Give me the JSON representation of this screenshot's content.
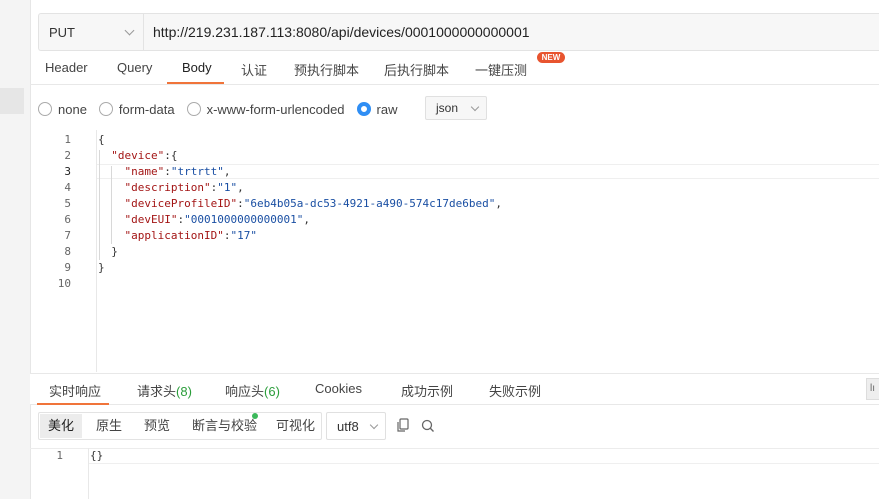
{
  "request": {
    "method": "PUT",
    "url": "http://219.231.187.113:8080/api/devices/0001000000000001"
  },
  "tabs": [
    {
      "label": "Header"
    },
    {
      "label": "Query"
    },
    {
      "label": "Body"
    },
    {
      "label": "认证"
    },
    {
      "label": "预执行脚本"
    },
    {
      "label": "后执行脚本"
    },
    {
      "label": "一键压测"
    }
  ],
  "active_tab": "Body",
  "new_badge": "NEW",
  "body_types": [
    {
      "label": "none",
      "selected": false
    },
    {
      "label": "form-data",
      "selected": false
    },
    {
      "label": "x-www-form-urlencoded",
      "selected": false
    },
    {
      "label": "raw",
      "selected": true
    }
  ],
  "raw_format": "json",
  "editor": {
    "line_numbers": [
      "1",
      "2",
      "3",
      "4",
      "5",
      "6",
      "7",
      "8",
      "9",
      "10"
    ],
    "active_line": "3",
    "lines": [
      [
        {
          "t": "{",
          "c": "p"
        }
      ],
      [
        {
          "t": "  ",
          "c": "p"
        },
        {
          "t": "\"device\"",
          "c": "k"
        },
        {
          "t": ":{",
          "c": "p"
        }
      ],
      [
        {
          "t": "    ",
          "c": "p"
        },
        {
          "t": "\"name\"",
          "c": "k"
        },
        {
          "t": ":",
          "c": "p"
        },
        {
          "t": "\"trtrtt\"",
          "c": "s"
        },
        {
          "t": ",",
          "c": "p"
        }
      ],
      [
        {
          "t": "    ",
          "c": "p"
        },
        {
          "t": "\"description\"",
          "c": "k"
        },
        {
          "t": ":",
          "c": "p"
        },
        {
          "t": "\"1\"",
          "c": "s"
        },
        {
          "t": ",",
          "c": "p"
        }
      ],
      [
        {
          "t": "    ",
          "c": "p"
        },
        {
          "t": "\"deviceProfileID\"",
          "c": "k"
        },
        {
          "t": ":",
          "c": "p"
        },
        {
          "t": "\"6eb4b05a-dc53-4921-a490-574c17de6bed\"",
          "c": "s"
        },
        {
          "t": ",",
          "c": "p"
        }
      ],
      [
        {
          "t": "    ",
          "c": "p"
        },
        {
          "t": "\"devEUI\"",
          "c": "k"
        },
        {
          "t": ":",
          "c": "p"
        },
        {
          "t": "\"0001000000000001\"",
          "c": "s"
        },
        {
          "t": ",",
          "c": "p"
        }
      ],
      [
        {
          "t": "    ",
          "c": "p"
        },
        {
          "t": "\"applicationID\"",
          "c": "k"
        },
        {
          "t": ":",
          "c": "p"
        },
        {
          "t": "\"17\"",
          "c": "s"
        }
      ],
      [
        {
          "t": "  }",
          "c": "p"
        }
      ],
      [
        {
          "t": "}",
          "c": "p"
        }
      ],
      []
    ]
  },
  "response_tabs": {
    "realtime": "实时响应",
    "req_headers": "请求头",
    "req_headers_count": "(8)",
    "resp_headers": "响应头",
    "resp_headers_count": "(6)",
    "cookies": "Cookies",
    "success_example": "成功示例",
    "fail_example": "失败示例"
  },
  "side_button": "lı",
  "view_modes": {
    "pretty": "美化",
    "raw": "原生",
    "preview": "预览",
    "assert": "断言与校验",
    "visualize": "可视化"
  },
  "encoding": "utf8",
  "icons": {
    "copy": "copy-icon",
    "search": "search-icon"
  },
  "colors": {
    "accent": "#f0743a",
    "radio_selected": "#2f8ef4",
    "count_green": "#2a9d3a",
    "badge": "#e8542f"
  },
  "response": {
    "line_numbers": [
      "1"
    ],
    "text": "{}"
  }
}
